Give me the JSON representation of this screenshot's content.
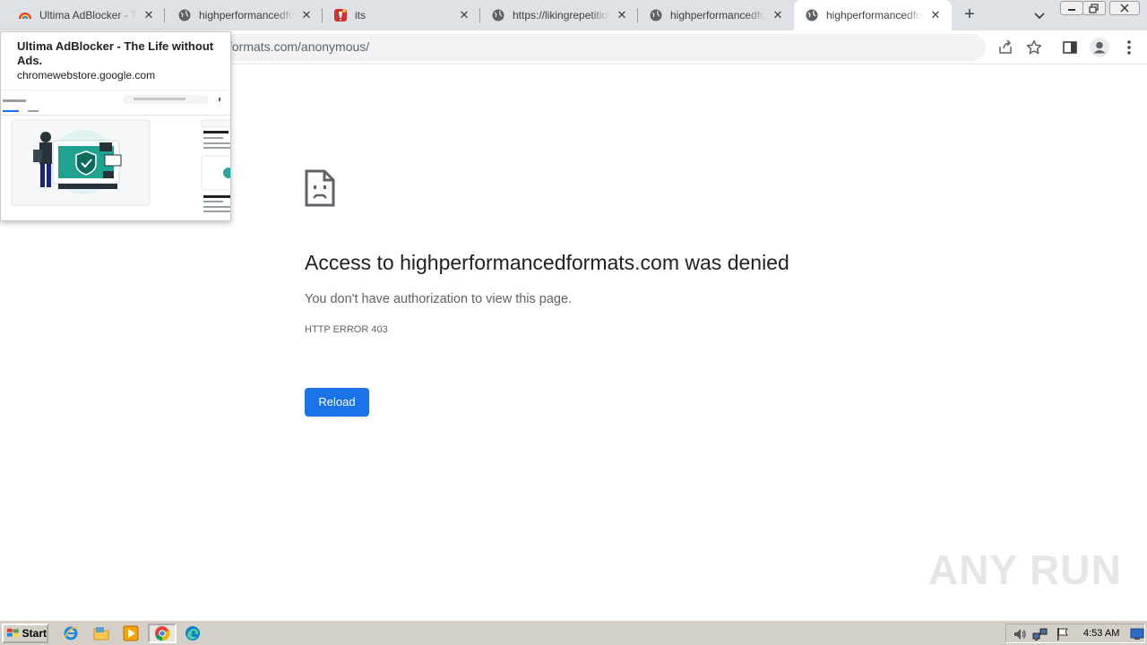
{
  "browser": {
    "tabs": [
      {
        "title": "Ultima AdBlocker - The Life without Ads.",
        "favicon": "rainbow-icon",
        "active": false
      },
      {
        "title": "highperformancedformats.com",
        "favicon": "globe-icon",
        "active": false
      },
      {
        "title": "its",
        "favicon": "red-flame-icon",
        "active": false
      },
      {
        "title": "https://likingrepetitious.com",
        "favicon": "globe-icon",
        "active": false
      },
      {
        "title": "highperformancedformats.com",
        "favicon": "globe-icon",
        "active": false
      },
      {
        "title": "highperformancedformats.com",
        "favicon": "globe-icon",
        "active": true
      }
    ],
    "new_tab_symbol": "+",
    "close_symbol": "✕",
    "url": "formats.com/anonymous/"
  },
  "hover_card": {
    "title": "Ultima AdBlocker - The Life without Ads.",
    "domain": "chromewebstore.google.com"
  },
  "error_page": {
    "heading": "Access to highperformancedformats.com was denied",
    "subtext": "You don't have authorization to view this page.",
    "code": "HTTP ERROR 403",
    "reload_label": "Reload"
  },
  "watermark": "ANY RUN",
  "taskbar": {
    "start_label": "Start",
    "clock": "4:53 AM"
  },
  "colors": {
    "tabstrip_bg": "#dee1e6",
    "accent_blue": "#1a73e8",
    "taskbar_bg": "#d4d0c8"
  }
}
